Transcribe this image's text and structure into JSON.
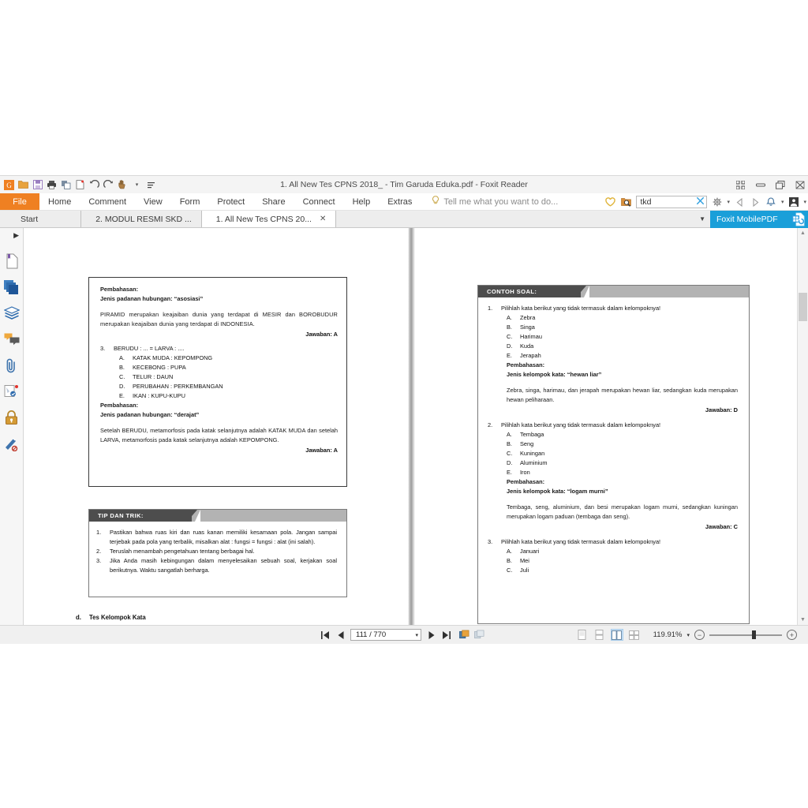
{
  "window": {
    "title": "1. All New Tes CPNS 2018_ - Tim Garuda Eduka.pdf - Foxit Reader",
    "quick_access": [
      "app-logo",
      "open",
      "save",
      "print",
      "print-preview",
      "new-blank",
      "undo",
      "redo",
      "hand-tool",
      "more"
    ],
    "controls": [
      "restore-grid",
      "minimize",
      "restore",
      "close"
    ]
  },
  "menubar": {
    "file_label": "File",
    "items": [
      "Home",
      "Comment",
      "View",
      "Form",
      "Protect",
      "Share",
      "Connect",
      "Help",
      "Extras"
    ],
    "tellme_placeholder": "Tell me what you want to do...",
    "search_value": "tkd",
    "right_icons": [
      "heart-icon",
      "search-folder-icon",
      "gear-icon",
      "prev-arrow-icon",
      "next-arrow-icon",
      "bell-icon",
      "account-icon"
    ]
  },
  "tabs": {
    "items": [
      {
        "label": "Start",
        "active": false,
        "closable": false
      },
      {
        "label": "2. MODUL RESMI SKD ...",
        "active": false,
        "closable": false
      },
      {
        "label": "1. All New Tes CPNS 20...",
        "active": true,
        "closable": true
      }
    ],
    "close_glyph": "✕",
    "mobilepdf_label": "Foxit MobilePDF"
  },
  "rail": {
    "items": [
      "collapse-panel-icon",
      "bookmark-page-icon",
      "pages-thumbnail-icon",
      "layers-icon",
      "comments-icon",
      "attachments-icon",
      "stamp-icon",
      "security-lock-icon",
      "signature-icon"
    ]
  },
  "statusbar": {
    "first_page_label": "first-page",
    "prev_page_label": "previous-page",
    "page_value": "111 / 770",
    "next_page_label": "next-page",
    "last_page_label": "last-page",
    "zoom_value": "119.91%",
    "view_modes": [
      "single-page",
      "continuous",
      "facing",
      "continuous-facing"
    ],
    "selected_view_mode_index": 2,
    "zoom_out_glyph": "−",
    "zoom_in_glyph": "+"
  },
  "document": {
    "left_page": {
      "block1": {
        "heading1": "Pembahasan:",
        "heading2": "Jenis padanan hubungan: “asosiasi”",
        "para": "PIRAMID merupakan keajaiban dunia yang terdapat di MESIR dan BOROBUDUR merupakan keajaiban dunia yang terdapat di INDONESIA.",
        "answer": "Jawaban: A",
        "q_num": "3.",
        "q_text": "BERUDU : ... = LARVA : ....",
        "options": [
          {
            "letter": "A.",
            "text": "KATAK MUDA : KEPOMPONG"
          },
          {
            "letter": "B.",
            "text": "KECEBONG : PUPA"
          },
          {
            "letter": "C.",
            "text": "TELUR : DAUN"
          },
          {
            "letter": "D.",
            "text": "PERUBAHAN : PERKEMBANGAN"
          },
          {
            "letter": "E.",
            "text": "IKAN : KUPU-KUPU"
          }
        ],
        "heading3": "Pembahasan:",
        "heading4": "Jenis padanan hubungan: “derajat”",
        "para2": "Setelah BERUDU, metamorfosis pada katak selanjutnya adalah KATAK MUDA dan setelah LARVA, metamorfosis pada katak selanjutnya adalah KEPOMPONG.",
        "answer2": "Jawaban: A"
      },
      "tips": {
        "banner": "TIP DAN TRIK:",
        "items": [
          {
            "n": "1.",
            "t": "Pastikan bahwa ruas kiri dan ruas kanan memiliki kesamaan pola. Jangan sampai terjebak pada pola yang terbalik, misalkan alat : fungsi = fungsi : alat (ini salah)."
          },
          {
            "n": "2.",
            "t": "Teruslah menambah pengetahuan tentang berbagai hal."
          },
          {
            "n": "3.",
            "t": "Jika Anda masih kebingungan dalam menyelesaikan sebuah soal, kerjakan soal berikutnya. Waktu sangatlah berharga."
          }
        ]
      },
      "section_letter": "d.",
      "section_title": "Tes Kelompok Kata"
    },
    "right_page": {
      "banner": "CONTOH SOAL:",
      "questions": [
        {
          "num": "1.",
          "text": "Pilihlah kata berikut yang tidak termasuk dalam kelompoknya!",
          "options": [
            {
              "letter": "A.",
              "text": "Zebra"
            },
            {
              "letter": "B.",
              "text": "Singa"
            },
            {
              "letter": "C.",
              "text": "Harimau"
            },
            {
              "letter": "D.",
              "text": "Kuda"
            },
            {
              "letter": "E.",
              "text": "Jerapah"
            }
          ],
          "heading1": "Pembahasan:",
          "heading2": "Jenis kelompok kata: “hewan liar”",
          "para": "Zebra, singa, harimau, dan jerapah merupakan hewan liar, sedangkan kuda merupakan hewan peliharaan.",
          "answer": "Jawaban: D"
        },
        {
          "num": "2.",
          "text": "Pilihlah kata berikut yang tidak termasuk dalam kelompoknya!",
          "options": [
            {
              "letter": "A.",
              "text": "Tembaga"
            },
            {
              "letter": "B.",
              "text": "Seng"
            },
            {
              "letter": "C.",
              "text": "Kuningan"
            },
            {
              "letter": "D.",
              "text": "Aluminium"
            },
            {
              "letter": "E.",
              "text": "Iron"
            }
          ],
          "heading1": "Pembahasan:",
          "heading2": "Jenis kelompok kata: “logam murni”",
          "para": "Tembaga, seng, aluminium, dan besi merupakan logam murni, sedangkan kuningan merupakan logam paduan (tembaga dan seng).",
          "answer": "Jawaban: C"
        },
        {
          "num": "3.",
          "text": "Pilihlah kata berikut yang tidak termasuk dalam kelompoknya!",
          "options": [
            {
              "letter": "A.",
              "text": "Januari"
            },
            {
              "letter": "B.",
              "text": "Mei"
            },
            {
              "letter": "C.",
              "text": "Juli"
            }
          ]
        }
      ]
    }
  },
  "colors": {
    "accent_orange": "#ef8022",
    "mobile_blue": "#1a9fd9",
    "banner_dark": "#4d4d4d",
    "banner_gray": "#b3b3b3"
  }
}
